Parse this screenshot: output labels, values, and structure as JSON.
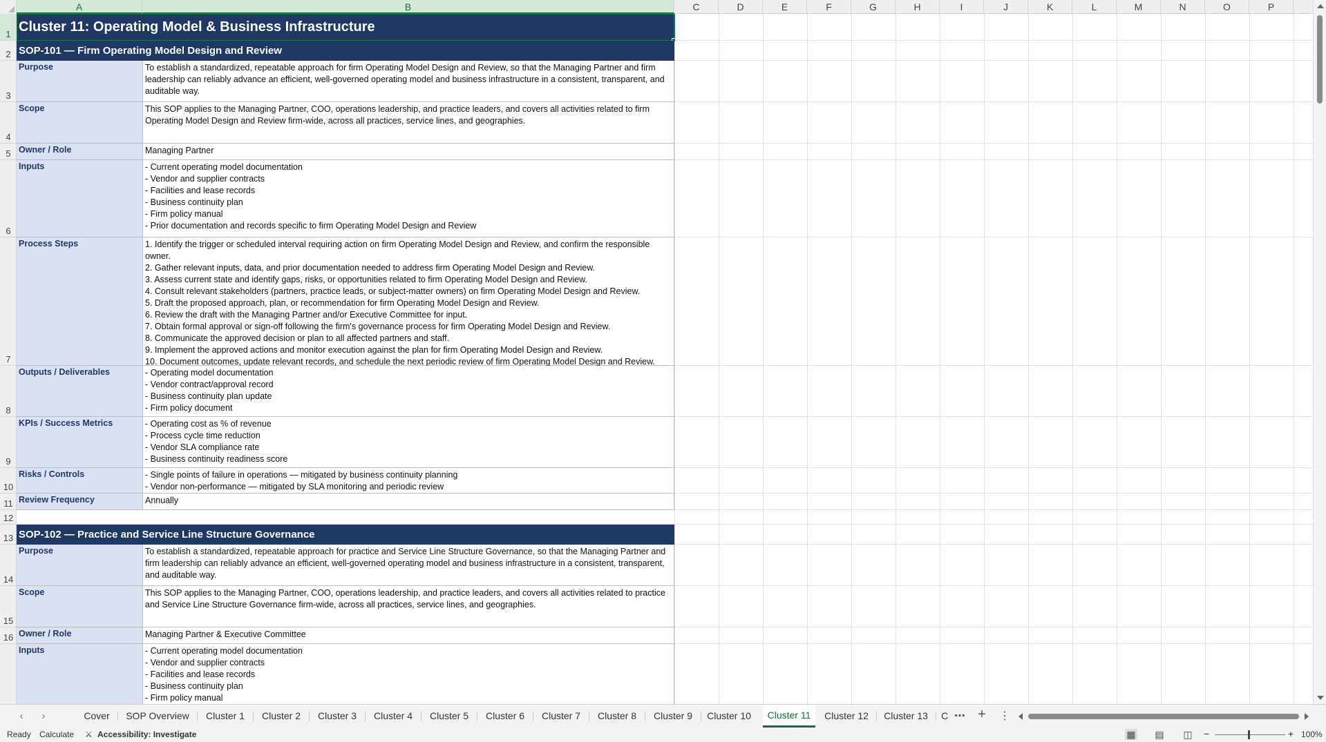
{
  "columns": [
    "A",
    "B",
    "C",
    "D",
    "E",
    "F",
    "G",
    "H",
    "I",
    "J",
    "K",
    "L",
    "M",
    "N",
    "O",
    "P"
  ],
  "rows": [
    "1",
    "2",
    "3",
    "4",
    "5",
    "6",
    "7",
    "8",
    "9",
    "10",
    "11",
    "12",
    "13",
    "14",
    "15",
    "16"
  ],
  "title": "Cluster 11: Operating Model & Business Infrastructure",
  "sop101": {
    "header": "SOP-101  —  Firm Operating Model Design and Review",
    "purpose_label": "Purpose",
    "purpose": "To establish a standardized, repeatable approach for firm Operating Model Design and Review, so that the Managing Partner and firm leadership can reliably advance an efficient, well-governed operating model and business infrastructure in a consistent, transparent, and auditable way.",
    "scope_label": "Scope",
    "scope": "This SOP applies to the Managing Partner, COO, operations leadership, and practice leaders, and covers all activities related to firm Operating Model Design and Review firm-wide, across all practices, service lines, and geographies.",
    "owner_label": "Owner / Role",
    "owner": "Managing Partner",
    "inputs_label": "Inputs",
    "inputs": "- Current operating model documentation\n- Vendor and supplier contracts\n- Facilities and lease records\n- Business continuity plan\n- Firm policy manual\n- Prior documentation and records specific to firm Operating Model Design and Review",
    "steps_label": "Process Steps",
    "steps": "1. Identify the trigger or scheduled interval requiring action on firm Operating Model Design and Review, and confirm the responsible owner.\n2. Gather relevant inputs, data, and prior documentation needed to address firm Operating Model Design and Review.\n3. Assess current state and identify gaps, risks, or opportunities related to firm Operating Model Design and Review.\n4. Consult relevant stakeholders (partners, practice leads, or subject-matter owners) on firm Operating Model Design and Review.\n5. Draft the proposed approach, plan, or recommendation for firm Operating Model Design and Review.\n6. Review the draft with the Managing Partner and/or Executive Committee for input.\n7. Obtain formal approval or sign-off following the firm's governance process for firm Operating Model Design and Review.\n8. Communicate the approved decision or plan to all affected partners and staff.\n9. Implement the approved actions and monitor execution against the plan for firm Operating Model Design and Review.\n10. Document outcomes, update relevant records, and schedule the next periodic review of firm Operating Model Design and Review.",
    "outputs_label": "Outputs / Deliverables",
    "outputs": "- Operating model documentation\n- Vendor contract/approval record\n- Business continuity plan update\n- Firm policy document",
    "kpis_label": "KPIs / Success Metrics",
    "kpis": "- Operating cost as % of revenue\n- Process cycle time reduction\n- Vendor SLA compliance rate\n- Business continuity readiness score",
    "risks_label": "Risks / Controls",
    "risks": "- Single points of failure in operations — mitigated by business continuity planning\n- Vendor non-performance — mitigated by SLA monitoring and periodic review",
    "review_label": "Review Frequency",
    "review": "Annually"
  },
  "sop102": {
    "header": "SOP-102  —  Practice and Service Line Structure Governance",
    "purpose_label": "Purpose",
    "purpose": "To establish a standardized, repeatable approach for practice and Service Line Structure Governance, so that the Managing Partner and firm leadership can reliably advance an efficient, well-governed operating model and business infrastructure in a consistent, transparent, and auditable way.",
    "scope_label": "Scope",
    "scope": "This SOP applies to the Managing Partner, COO, operations leadership, and practice leaders, and covers all activities related to practice and Service Line Structure Governance firm-wide, across all practices, service lines, and geographies.",
    "owner_label": "Owner / Role",
    "owner": "Managing Partner & Executive Committee",
    "inputs_label": "Inputs",
    "inputs": "- Current operating model documentation\n- Vendor and supplier contracts\n- Facilities and lease records\n- Business continuity plan\n- Firm policy manual"
  },
  "tabs": [
    "Cover",
    "SOP Overview",
    "Cluster 1",
    "Cluster 2",
    "Cluster 3",
    "Cluster 4",
    "Cluster 5",
    "Cluster 6",
    "Cluster 7",
    "Cluster 8",
    "Cluster 9",
    "Cluster 10",
    "Cluster 11",
    "Cluster 12",
    "Cluster 13",
    "C"
  ],
  "active_tab": "Cluster 11",
  "status": {
    "ready": "Ready",
    "calculate": "Calculate",
    "accessibility": "Accessibility: Investigate",
    "zoom": "100%"
  },
  "colors": {
    "header_navy": "#1f3864",
    "label_fill": "#d9e1f2",
    "excel_green": "#217346"
  }
}
